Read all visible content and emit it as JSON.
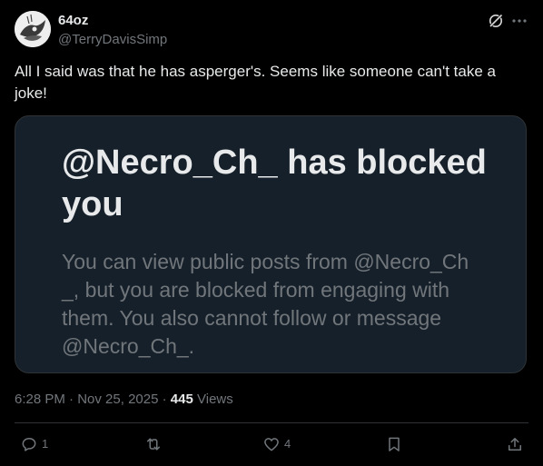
{
  "author": {
    "display_name": "64oz",
    "handle": "@TerryDavisSimp",
    "avatar_icon": "avatar-image"
  },
  "post": {
    "text": "All I said was that he has asperger's. Seems like someone can't take a joke!"
  },
  "blocked_card": {
    "title": "@Necro_Ch_ has blocked you",
    "description": "You can view public posts from @Necro_Ch _, but you are blocked from engaging with them. You also cannot follow or message @Necro_Ch_."
  },
  "meta": {
    "time": "6:28 PM",
    "date": "Nov 25, 2025",
    "separator": "·",
    "views_count": "445",
    "views_label": "Views"
  },
  "actions": {
    "reply_count": "1",
    "repost_count": "",
    "like_count": "4"
  },
  "colors": {
    "background": "#000000",
    "card_background": "#16202a",
    "primary_text": "#e7e9ea",
    "secondary_text": "#71767b",
    "border": "#2f3336"
  }
}
